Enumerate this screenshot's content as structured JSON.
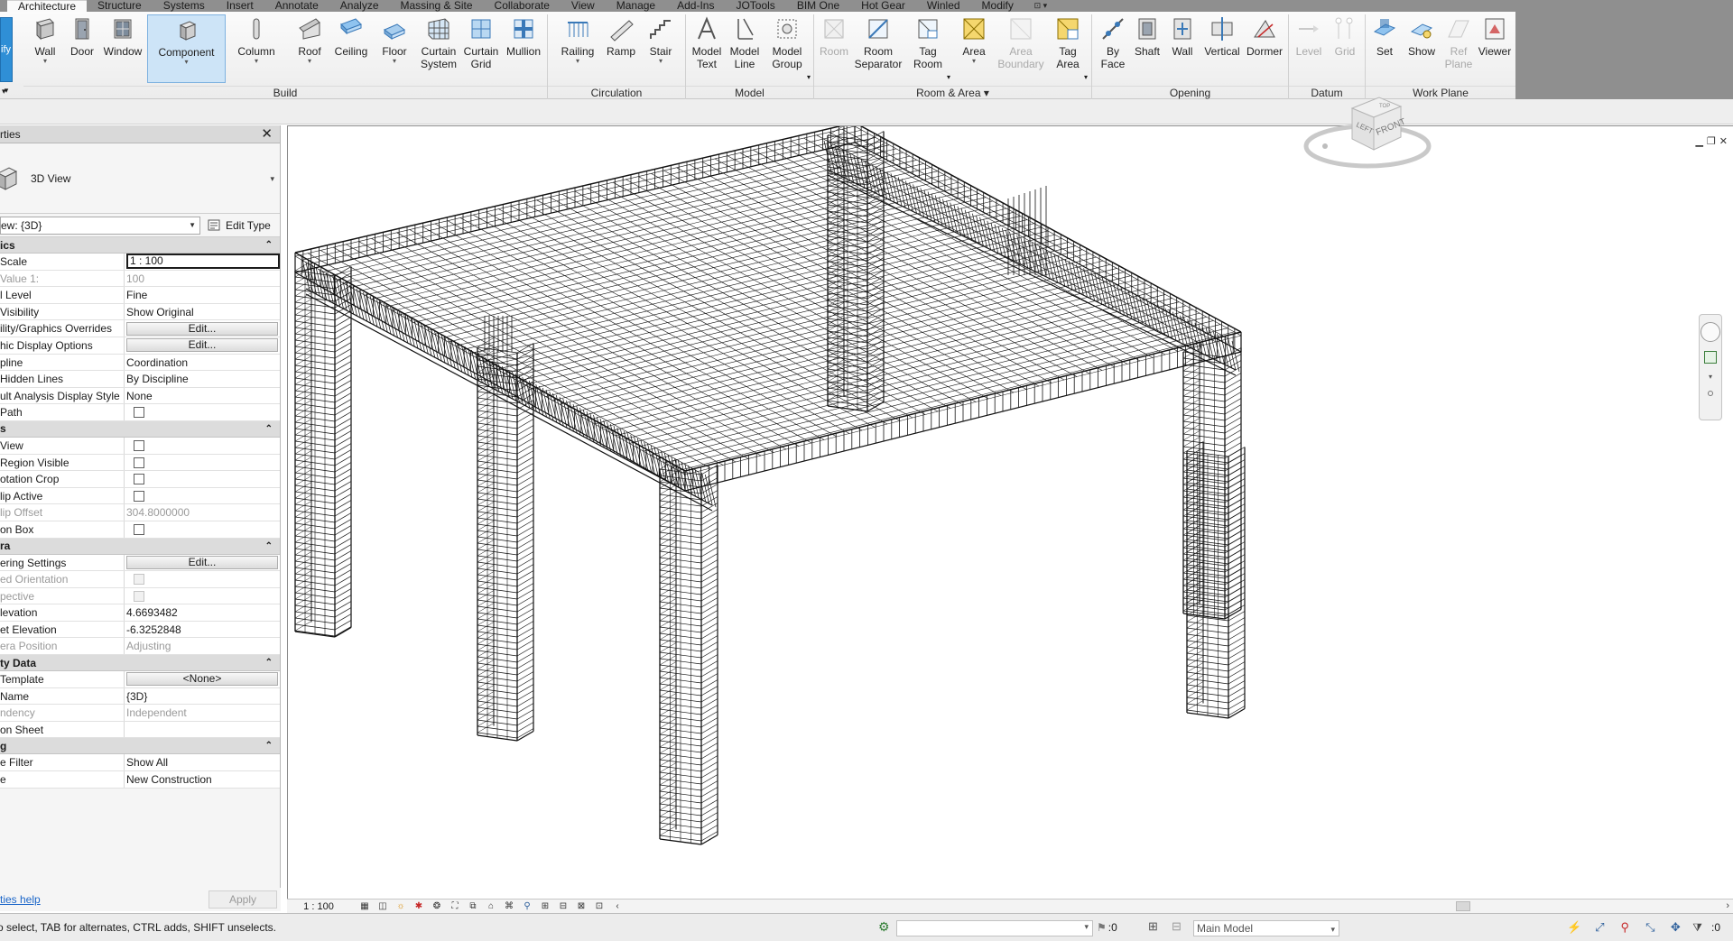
{
  "tabs": [
    {
      "label": "Architecture",
      "active": true
    },
    {
      "label": "Structure"
    },
    {
      "label": "Systems"
    },
    {
      "label": "Insert"
    },
    {
      "label": "Annotate"
    },
    {
      "label": "Analyze"
    },
    {
      "label": "Massing & Site"
    },
    {
      "label": "Collaborate"
    },
    {
      "label": "View"
    },
    {
      "label": "Manage"
    },
    {
      "label": "Add-Ins"
    },
    {
      "label": "JOTools"
    },
    {
      "label": "BIM One"
    },
    {
      "label": "Hot Gear"
    },
    {
      "label": "Winled"
    },
    {
      "label": "Modify"
    }
  ],
  "ribbon": {
    "modify_stub": "ify",
    "buttons": {
      "wall": "Wall",
      "door": "Door",
      "window": "Window",
      "component": "Component",
      "column": "Column",
      "roof": "Roof",
      "ceiling": "Ceiling",
      "floor": "Floor",
      "curtain_system": "Curtain System",
      "curtain_grid": "Curtain Grid",
      "mullion": "Mullion",
      "railing": "Railing",
      "ramp": "Ramp",
      "stair": "Stair",
      "model_text": "Model Text",
      "model_line": "Model Line",
      "model_group": "Model Group",
      "room": "Room",
      "room_separator": "Room Separator",
      "tag_room": "Tag Room",
      "area": "Area",
      "area_boundary": "Area Boundary",
      "tag_area": "Tag Area",
      "by_face": "By Face",
      "shaft": "Shaft",
      "wall_opening": "Wall",
      "vertical": "Vertical",
      "dormer": "Dormer",
      "level": "Level",
      "grid": "Grid",
      "set": "Set",
      "show": "Show",
      "ref_plane": "Ref Plane",
      "viewer": "Viewer"
    },
    "panels": {
      "build": "Build",
      "circulation": "Circulation",
      "model": "Model",
      "room_area": "Room & Area",
      "opening": "Opening",
      "datum": "Datum",
      "work_plane": "Work Plane"
    }
  },
  "properties": {
    "header": "rties",
    "type_name": "3D View",
    "selector": "ew: {3D}",
    "edit_type": "Edit Type",
    "groups": {
      "graphics": "ics",
      "extents": "s",
      "camera": "ra",
      "identity": "ty Data",
      "phasing": "g"
    },
    "rows": {
      "view_scale": {
        "name": "Scale",
        "value": "1 : 100"
      },
      "scale_value": {
        "name": "Value    1:",
        "value": "100"
      },
      "detail_level": {
        "name": "l Level",
        "value": "Fine"
      },
      "parts_visibility": {
        "name": "Visibility",
        "value": "Show Original"
      },
      "vg_overrides": {
        "name": "ility/Graphics Overrides",
        "value": "Edit..."
      },
      "graphic_display": {
        "name": "hic Display Options",
        "value": "Edit..."
      },
      "discipline": {
        "name": "pline",
        "value": "Coordination"
      },
      "hidden_lines": {
        "name": "Hidden Lines",
        "value": "By Discipline"
      },
      "analysis_style": {
        "name": "ult Analysis Display Style",
        "value": "None"
      },
      "sun_path": {
        "name": "Path"
      },
      "crop_view": {
        "name": "View"
      },
      "crop_region": {
        "name": "Region Visible"
      },
      "annotation_crop": {
        "name": "otation Crop"
      },
      "far_clip": {
        "name": "lip Active"
      },
      "far_clip_offset": {
        "name": "lip Offset",
        "value": "304.8000000"
      },
      "section_box": {
        "name": "on Box"
      },
      "rendering": {
        "name": "ering Settings",
        "value": "Edit..."
      },
      "locked_orientation": {
        "name": "ed Orientation"
      },
      "perspective": {
        "name": "pective"
      },
      "eye_elevation": {
        "name": "levation",
        "value": "4.6693482"
      },
      "target_elevation": {
        "name": "et Elevation",
        "value": "-6.3252848"
      },
      "camera_position": {
        "name": "era Position",
        "value": "Adjusting"
      },
      "view_template": {
        "name": "Template",
        "value": "<None>"
      },
      "view_name": {
        "name": "Name",
        "value": "{3D}"
      },
      "dependency": {
        "name": "ndency",
        "value": "Independent"
      },
      "title_on_sheet": {
        "name": "on Sheet",
        "value": ""
      },
      "phase_filter": {
        "name": "e Filter",
        "value": "Show All"
      },
      "phase": {
        "name": "e",
        "value": "New Construction"
      }
    },
    "help_link": "rties help",
    "apply": "Apply"
  },
  "viewbar": {
    "scale": "1 : 100"
  },
  "statusbar": {
    "message": "o select, TAB for alternates, CTRL adds, SHIFT unselects.",
    "zero": ":0",
    "main_model": "Main Model",
    "filter_count": ":0"
  },
  "viewcube": {
    "front": "FRONT",
    "left": "LEFT",
    "top": "TOP"
  },
  "colors": {
    "accent": "#2f8fd6",
    "selected_bg": "#cde4f7",
    "ribbon_bg": "#f3f3f3"
  }
}
